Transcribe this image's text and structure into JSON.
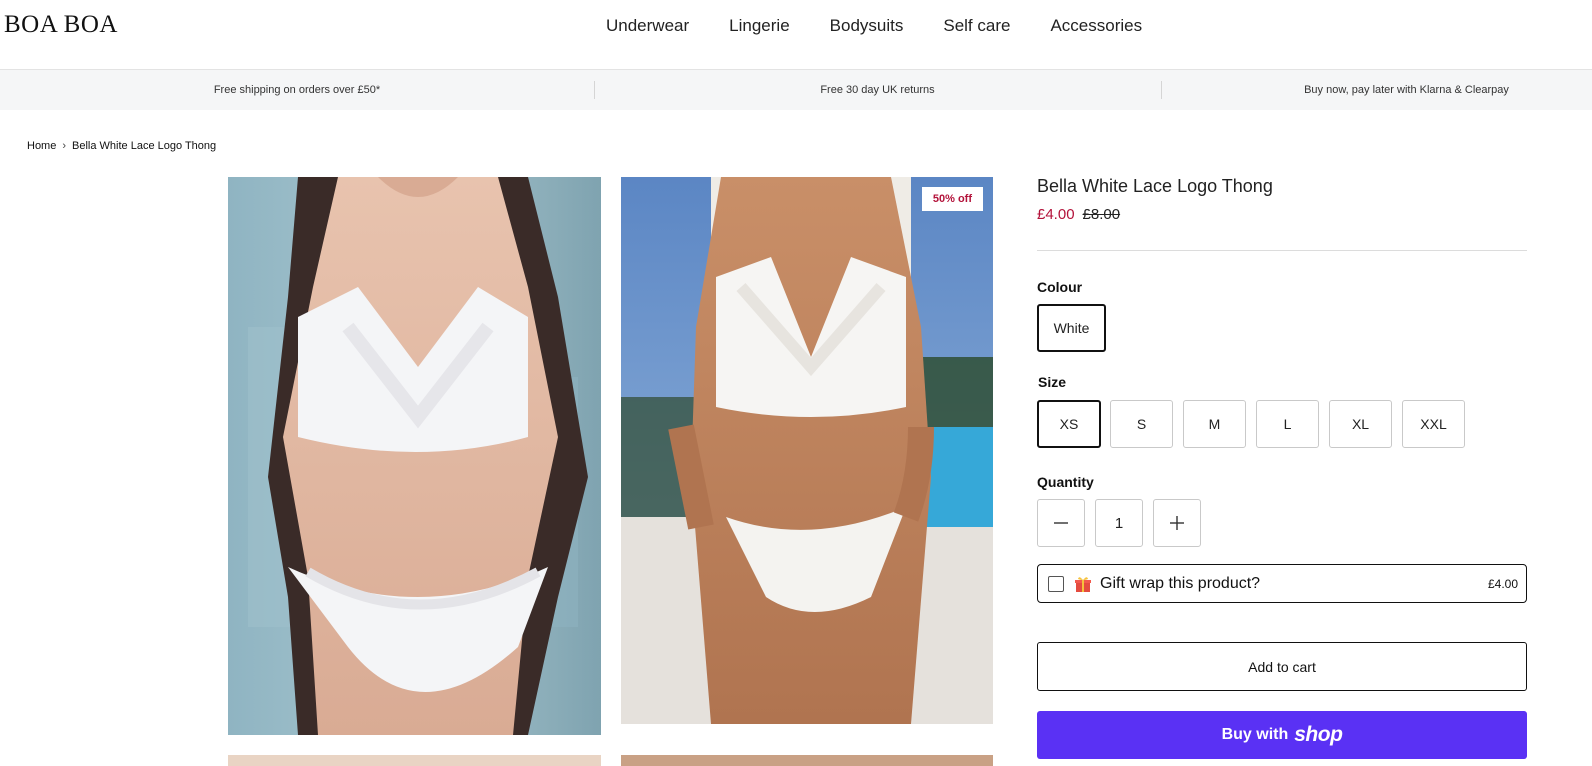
{
  "header": {
    "logo": "BOA BOA",
    "nav": [
      "Underwear",
      "Lingerie",
      "Bodysuits",
      "Self care",
      "Accessories"
    ]
  },
  "announcements": [
    "Free shipping on orders over £50*",
    "Free 30 day UK returns",
    "Buy now, pay later with Klarna & Clearpay"
  ],
  "breadcrumb": {
    "home": "Home",
    "current": "Bella White Lace Logo Thong"
  },
  "gallery": {
    "badge": "50% off"
  },
  "product": {
    "title": "Bella White Lace Logo Thong",
    "price": "£4.00",
    "compare_price": "£8.00",
    "colour_label": "Colour",
    "colours": [
      "White"
    ],
    "selected_colour": "White",
    "size_label": "Size",
    "sizes": [
      "XS",
      "S",
      "M",
      "L",
      "XL",
      "XXL"
    ],
    "selected_size": "XS",
    "quantity_label": "Quantity",
    "quantity": "1",
    "gift_label": "Gift wrap this product?",
    "gift_price": "£4.00",
    "add_to_cart": "Add to cart",
    "buy_with": "Buy with",
    "shop_word": "shop"
  },
  "colors": {
    "sale_red": "#b3123a",
    "shop_purple": "#5a31f4",
    "announce_bg": "#f5f6f7"
  }
}
